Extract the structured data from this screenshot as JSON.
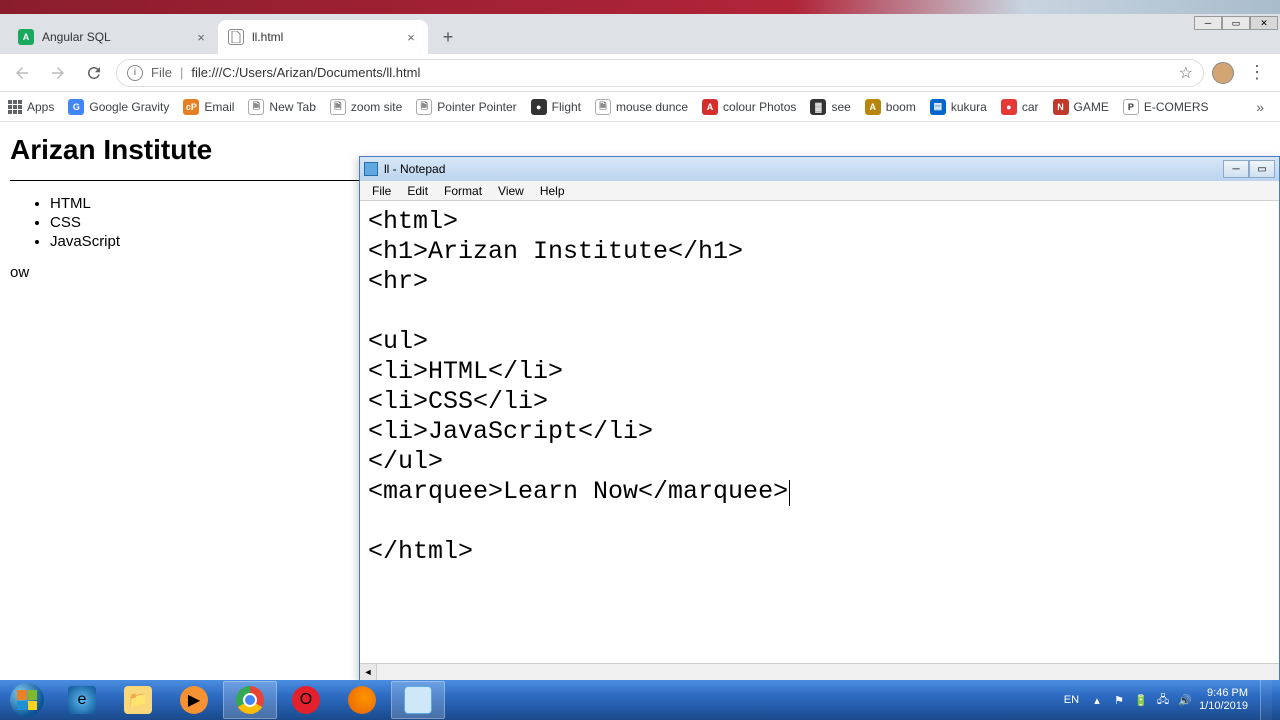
{
  "topbar": {},
  "browser": {
    "tabs": [
      {
        "title": "Angular SQL",
        "favicon": "A"
      },
      {
        "title": "ll.html",
        "favicon": "doc"
      }
    ],
    "url": {
      "file_label": "File",
      "path": "file:///C:/Users/Arizan/Documents/ll.html"
    }
  },
  "bookmarks": [
    {
      "label": "Apps",
      "icon": "apps",
      "color": ""
    },
    {
      "label": "Google Gravity",
      "icon": "G",
      "color": "#4285f4"
    },
    {
      "label": "Email",
      "icon": "cP",
      "color": "#e67e22"
    },
    {
      "label": "New Tab",
      "icon": "🗎",
      "color": "#888"
    },
    {
      "label": "zoom site",
      "icon": "🗎",
      "color": "#888"
    },
    {
      "label": "Pointer Pointer",
      "icon": "🗎",
      "color": "#888"
    },
    {
      "label": "Flight",
      "icon": "●",
      "color": "#333"
    },
    {
      "label": "mouse dunce",
      "icon": "🗎",
      "color": "#888"
    },
    {
      "label": "colour Photos",
      "icon": "A",
      "color": "#d32f2f"
    },
    {
      "label": "see",
      "icon": "▓",
      "color": "#333"
    },
    {
      "label": "boom",
      "icon": "A",
      "color": "#b8860b"
    },
    {
      "label": "kukura",
      "icon": "▤",
      "color": "#0066cc"
    },
    {
      "label": "car",
      "icon": "●",
      "color": "#e53935"
    },
    {
      "label": "GAME",
      "icon": "N",
      "color": "#c0392b"
    },
    {
      "label": "E-COMERS",
      "icon": "P",
      "color": "#333"
    }
  ],
  "page": {
    "heading": "Arizan Institute",
    "list_items": [
      "HTML",
      "CSS",
      "JavaScript"
    ],
    "marquee_fragment": "ow"
  },
  "notepad": {
    "title": "ll - Notepad",
    "menu": [
      "File",
      "Edit",
      "Format",
      "View",
      "Help"
    ],
    "lines": [
      "<html>",
      "<h1>Arizan Institute</h1>",
      "<hr>",
      "",
      "<ul>",
      "<li>HTML</li>",
      "<li>CSS</li>",
      "<li>JavaScript</li>",
      "</ul>",
      "<marquee>Learn Now</marquee>",
      "",
      "</html>"
    ],
    "cursor_after_line_index": 9
  },
  "systray": {
    "lang": "EN",
    "time": "9:46 PM",
    "date": "1/10/2019"
  }
}
